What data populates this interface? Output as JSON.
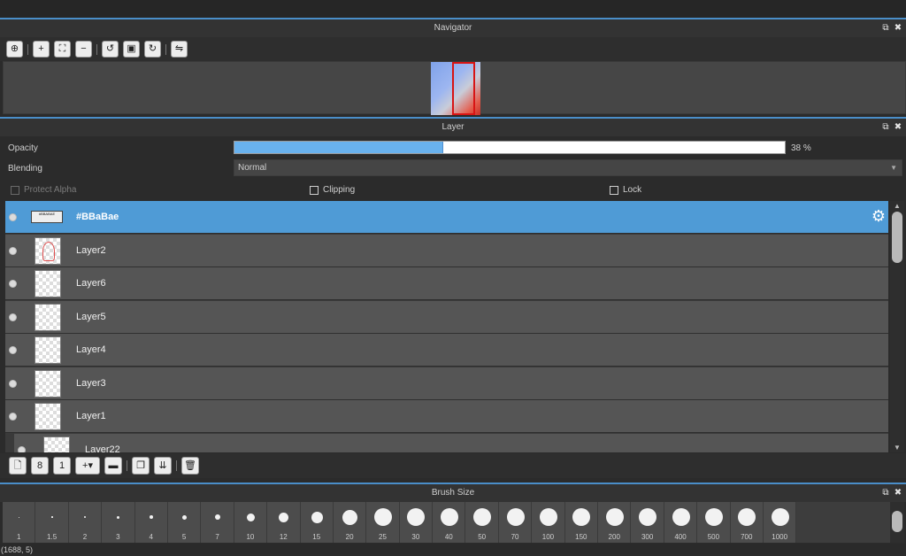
{
  "navigator": {
    "title": "Navigator",
    "tools": [
      "zoom-reset-icon",
      "zoom-in-icon",
      "fit-window-icon",
      "zoom-out-icon",
      "rotate-left-icon",
      "fit-actual-icon",
      "rotate-right-icon",
      "flip-horizontal-icon"
    ]
  },
  "layer": {
    "title": "Layer",
    "opacity_label": "Opacity",
    "opacity_value": "38 %",
    "opacity_fraction": 0.38,
    "blending_label": "Blending",
    "blending_value": "Normal",
    "protect_alpha_label": "Protect Alpha",
    "clipping_label": "Clipping",
    "lock_label": "Lock",
    "layers": [
      {
        "name": "#BBaBae",
        "thumb_text": "#BBABAE",
        "selected": true
      },
      {
        "name": "Layer2"
      },
      {
        "name": "Layer6"
      },
      {
        "name": "Layer5"
      },
      {
        "name": "Layer4"
      },
      {
        "name": "Layer3"
      },
      {
        "name": "Layer1"
      },
      {
        "name": "Layer22"
      }
    ]
  },
  "brush": {
    "title": "Brush Size",
    "sizes": [
      "1",
      "1.5",
      "2",
      "3",
      "4",
      "5",
      "7",
      "10",
      "12",
      "15",
      "20",
      "25",
      "30",
      "40",
      "50",
      "70",
      "100",
      "150",
      "200",
      "300",
      "400",
      "500",
      "700",
      "1000"
    ]
  },
  "status_text": "(1688, 5)",
  "colors": {
    "accent": "#4a8ec9",
    "selected_row": "#4f9bd6",
    "opacity_fill": "#69b2ee"
  }
}
